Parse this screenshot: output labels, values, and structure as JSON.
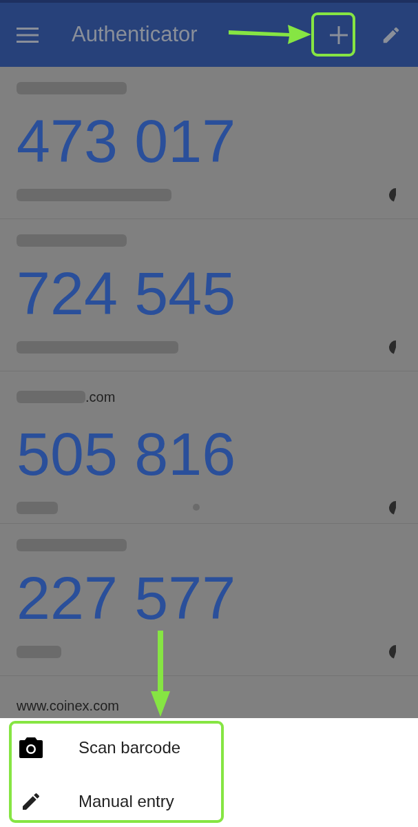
{
  "app_bar": {
    "title": "Authenticator"
  },
  "accounts": [
    {
      "issuer_redacted": true,
      "code": "473 017",
      "account_redacted": true,
      "level": 0.45
    },
    {
      "issuer_redacted": true,
      "code": "724 545",
      "account_redacted": true,
      "level": 0.45
    },
    {
      "issuer_redacted": true,
      "issuer": ".com",
      "code": "505 816",
      "account_redacted": true,
      "level": 0.45
    },
    {
      "issuer_redacted": true,
      "code": "227 577",
      "account_redacted": true,
      "level": 0.45
    },
    {
      "issuer_redacted": false,
      "issuer": "www.coinex.com"
    }
  ],
  "sheet": {
    "items": [
      {
        "kind": "camera",
        "label": "Scan barcode"
      },
      {
        "kind": "pencil",
        "label": "Manual entry"
      }
    ]
  }
}
